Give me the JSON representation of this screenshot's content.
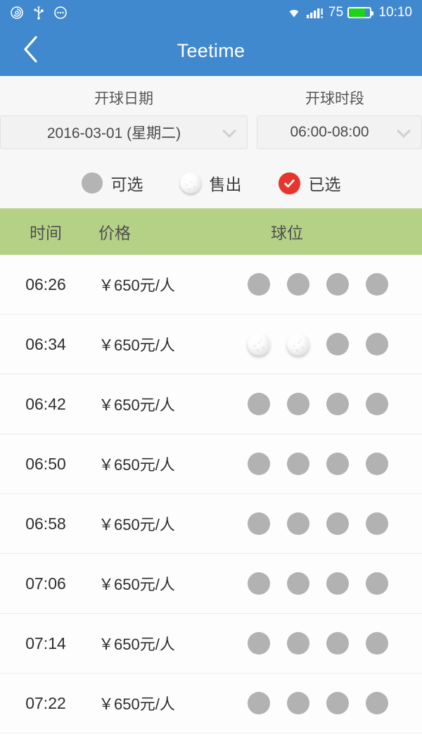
{
  "status_bar": {
    "left_icons": [
      "alarm-icon",
      "usb-icon",
      "more-icon"
    ],
    "wifi_icon": "wifi-icon",
    "signal_icon": "signal-bars-icon",
    "battery_level": "75",
    "battery_icon": "battery-icon",
    "time": "10:10"
  },
  "title_bar": {
    "back_icon": "back-chevron-icon",
    "title": "Teetime"
  },
  "filters": {
    "date": {
      "label": "开球日期",
      "value": "2016-03-01 (星期二)",
      "chevron_icon": "chevron-down-icon"
    },
    "time_range": {
      "label": "开球时段",
      "value": "06:00-08:00",
      "chevron_icon": "chevron-down-icon"
    }
  },
  "legend": [
    {
      "key": "available",
      "label": "可选",
      "icon": "gray-circle-icon"
    },
    {
      "key": "sold",
      "label": "售出",
      "icon": "golf-ball-icon"
    },
    {
      "key": "selected",
      "label": "已选",
      "icon": "red-check-circle-icon"
    }
  ],
  "table": {
    "headers": {
      "time": "时间",
      "price": "价格",
      "slots": "球位"
    },
    "rows": [
      {
        "time": "06:26",
        "price": "￥650元/人",
        "slots": [
          "available",
          "available",
          "available",
          "available"
        ]
      },
      {
        "time": "06:34",
        "price": "￥650元/人",
        "slots": [
          "sold",
          "sold",
          "available",
          "available"
        ]
      },
      {
        "time": "06:42",
        "price": "￥650元/人",
        "slots": [
          "available",
          "available",
          "available",
          "available"
        ]
      },
      {
        "time": "06:50",
        "price": "￥650元/人",
        "slots": [
          "available",
          "available",
          "available",
          "available"
        ]
      },
      {
        "time": "06:58",
        "price": "￥650元/人",
        "slots": [
          "available",
          "available",
          "available",
          "available"
        ]
      },
      {
        "time": "07:06",
        "price": "￥650元/人",
        "slots": [
          "available",
          "available",
          "available",
          "available"
        ]
      },
      {
        "time": "07:14",
        "price": "￥650元/人",
        "slots": [
          "available",
          "available",
          "available",
          "available"
        ]
      },
      {
        "time": "07:22",
        "price": "￥650元/人",
        "slots": [
          "available",
          "available",
          "available",
          "available"
        ]
      }
    ]
  },
  "colors": {
    "header_blue": "#4189ce",
    "table_header_green": "#b5d186",
    "selected_red": "#e8352b",
    "available_gray": "#b2b2b2",
    "battery_green": "#1fd219"
  }
}
